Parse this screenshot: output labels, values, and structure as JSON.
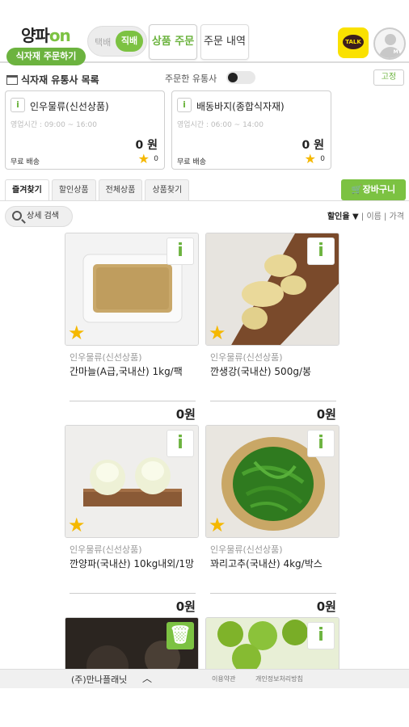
{
  "header": {
    "logo_main": "양파",
    "logo_on": "on",
    "logo_button": "식자재 주문하기",
    "ship_off": "택배",
    "ship_on": "직배",
    "tab_order": "상품 주문",
    "tab_history": "주문 내역",
    "talk_label": "TALK",
    "my_label": "MY"
  },
  "distributors": {
    "title": "식자재 유통사 목록",
    "ordered_label": "주문한 유통사",
    "fix_label": "고정",
    "cards": [
      {
        "name": "인우물류(신선상품)",
        "hours": "영업시간 : 09:00 ~ 16:00",
        "price": "0 원",
        "delivery": "무료 배송",
        "stars": "0"
      },
      {
        "name": "배동바지(종합식자재)",
        "hours": "영업시간 : 06:00 ~ 14:00",
        "price": "0 원",
        "delivery": "무료 배송",
        "stars": "0"
      }
    ]
  },
  "tabs": [
    "즐겨찾기",
    "할인상품",
    "전체상품",
    "상품찾기"
  ],
  "cart_label": "장바구니",
  "search_label": "상세 검색",
  "sort": {
    "selected": "할인율 ▼",
    "sep1": " | ",
    "opt1": "이름",
    "sep2": " | ",
    "opt2": "가격"
  },
  "products": [
    {
      "seller": "인우물류(신선상품)",
      "title": "간마늘(A급,국내산) 1kg/팩",
      "price": "0원",
      "image": "minced-garlic"
    },
    {
      "seller": "인우물류(신선상품)",
      "title": "깐생강(국내산) 500g/봉",
      "price": "0원",
      "image": "ginger"
    },
    {
      "seller": "인우물류(신선상품)",
      "title": "깐양파(국내산) 10kg내외/1망",
      "price": "0원",
      "image": "onion"
    },
    {
      "seller": "인우물류(신선상품)",
      "title": "꽈리고추(국내산) 4kg/박스",
      "price": "0원",
      "image": "shishito-pepper"
    }
  ],
  "footer": {
    "company": "(주)만나플래닛",
    "terms": "이용약관",
    "privacy": "개인정보처리방침"
  },
  "colors": {
    "accent": "#7cc242",
    "accent_dark": "#6cb33f",
    "star": "#f5b800",
    "kakao": "#fae100"
  }
}
